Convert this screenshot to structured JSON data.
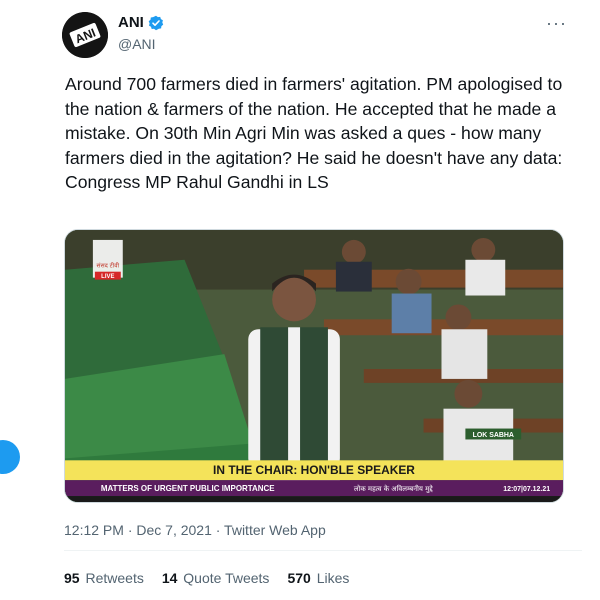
{
  "author": {
    "display_name": "ANI",
    "handle": "@ANI",
    "avatar_text": "ANI"
  },
  "tweet": {
    "text": "Around 700 farmers died in farmers' agitation. PM apologised to the nation & farmers of the nation. He accepted that he made a mistake. On 30th Min Agri Min was asked a ques - how many farmers died in the agitation? He said he doesn't have any data: Congress MP Rahul Gandhi in LS",
    "timestamp": "12:12 PM · Dec 7, 2021 · Twitter Web App"
  },
  "media": {
    "channel_logo_text": "संसद टीवी",
    "live_label": "LIVE",
    "lok_sabha_label": "LOK SABHA",
    "chair_banner": "IN THE CHAIR: HON'BLE SPEAKER",
    "ticker_left": "MATTERS OF URGENT PUBLIC IMPORTANCE",
    "ticker_right": "लोक महत्व के अविलम्बनीय मुद्दे",
    "ticker_time": "12:07|07.12.21"
  },
  "stats": {
    "retweets_count": "95",
    "retweets_label": "Retweets",
    "quotes_count": "14",
    "quotes_label": "Quote Tweets",
    "likes_count": "570",
    "likes_label": "Likes"
  },
  "colors": {
    "accent": "#1d9bf0",
    "text": "#0f1419",
    "muted": "#536471"
  },
  "icons": [
    "verified-badge-icon",
    "more-options-icon"
  ]
}
